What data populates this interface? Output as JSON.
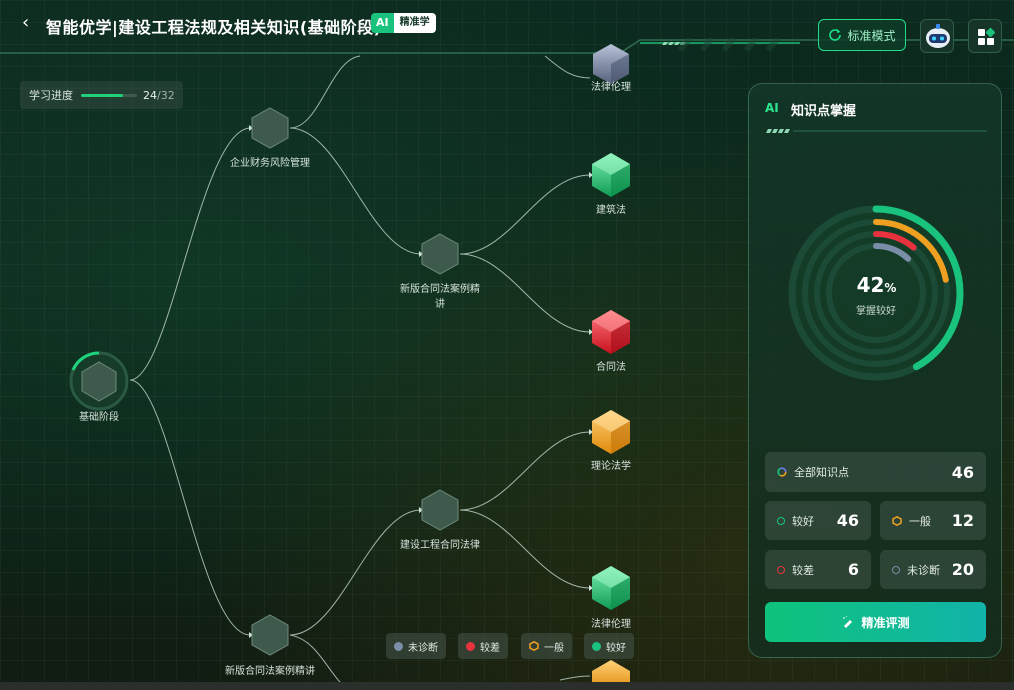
{
  "header": {
    "title": "智能优学|建设工程法规及相关知识(基础阶段)",
    "badge_ai": "AI",
    "badge_text": "精准学",
    "mode_button": "标准模式"
  },
  "progress": {
    "label": "学习进度",
    "current": "24",
    "total": "/32",
    "fraction": 0.75
  },
  "tree": {
    "root": "基础阶段",
    "level1": [
      {
        "label": "企业财务风险管理"
      },
      {
        "label": "新版合同法案例精讲"
      }
    ],
    "level2": [
      {
        "label": "新版合同法案例精讲"
      },
      {
        "label": "建设工程合同法律"
      }
    ],
    "leaves": [
      {
        "label": "法律伦理",
        "status": "未诊断"
      },
      {
        "label": "建筑法",
        "status": "较好"
      },
      {
        "label": "合同法",
        "status": "较差"
      },
      {
        "label": "理论法学",
        "status": "一般"
      },
      {
        "label": "法律伦理",
        "status": "较好"
      }
    ]
  },
  "legend": [
    {
      "label": "未诊断",
      "color": "#7a8ea8",
      "shape": "dot"
    },
    {
      "label": "较差",
      "color": "#e8333f",
      "shape": "dot"
    },
    {
      "label": "一般",
      "color": "#f0a020",
      "shape": "hex-outline"
    },
    {
      "label": "较好",
      "color": "#19c37d",
      "shape": "dot"
    }
  ],
  "panel": {
    "ai": "AI",
    "title": "知识点掌握",
    "mastery_percent": "42",
    "mastery_unit": "%",
    "mastery_fraction": 0.42,
    "mastery_label": "掌握较好",
    "all_label": "全部知识点",
    "all_count": "46",
    "stats": [
      {
        "label": "较好",
        "count": "46",
        "color": "#19c37d"
      },
      {
        "label": "一般",
        "count": "12",
        "color": "#f0a020"
      },
      {
        "label": "较差",
        "count": "6",
        "color": "#e8333f"
      },
      {
        "label": "未诊断",
        "count": "20",
        "color": "#7a8ea8"
      }
    ],
    "eval_button": "精准评测"
  },
  "colors": {
    "accent": "#19c37d",
    "warn": "#f0a020",
    "bad": "#e8333f",
    "unknown": "#7a8ea8"
  },
  "icons": [
    "back-arrow-icon",
    "refresh-icon",
    "robot-icon",
    "apps-icon",
    "pen-icon"
  ]
}
